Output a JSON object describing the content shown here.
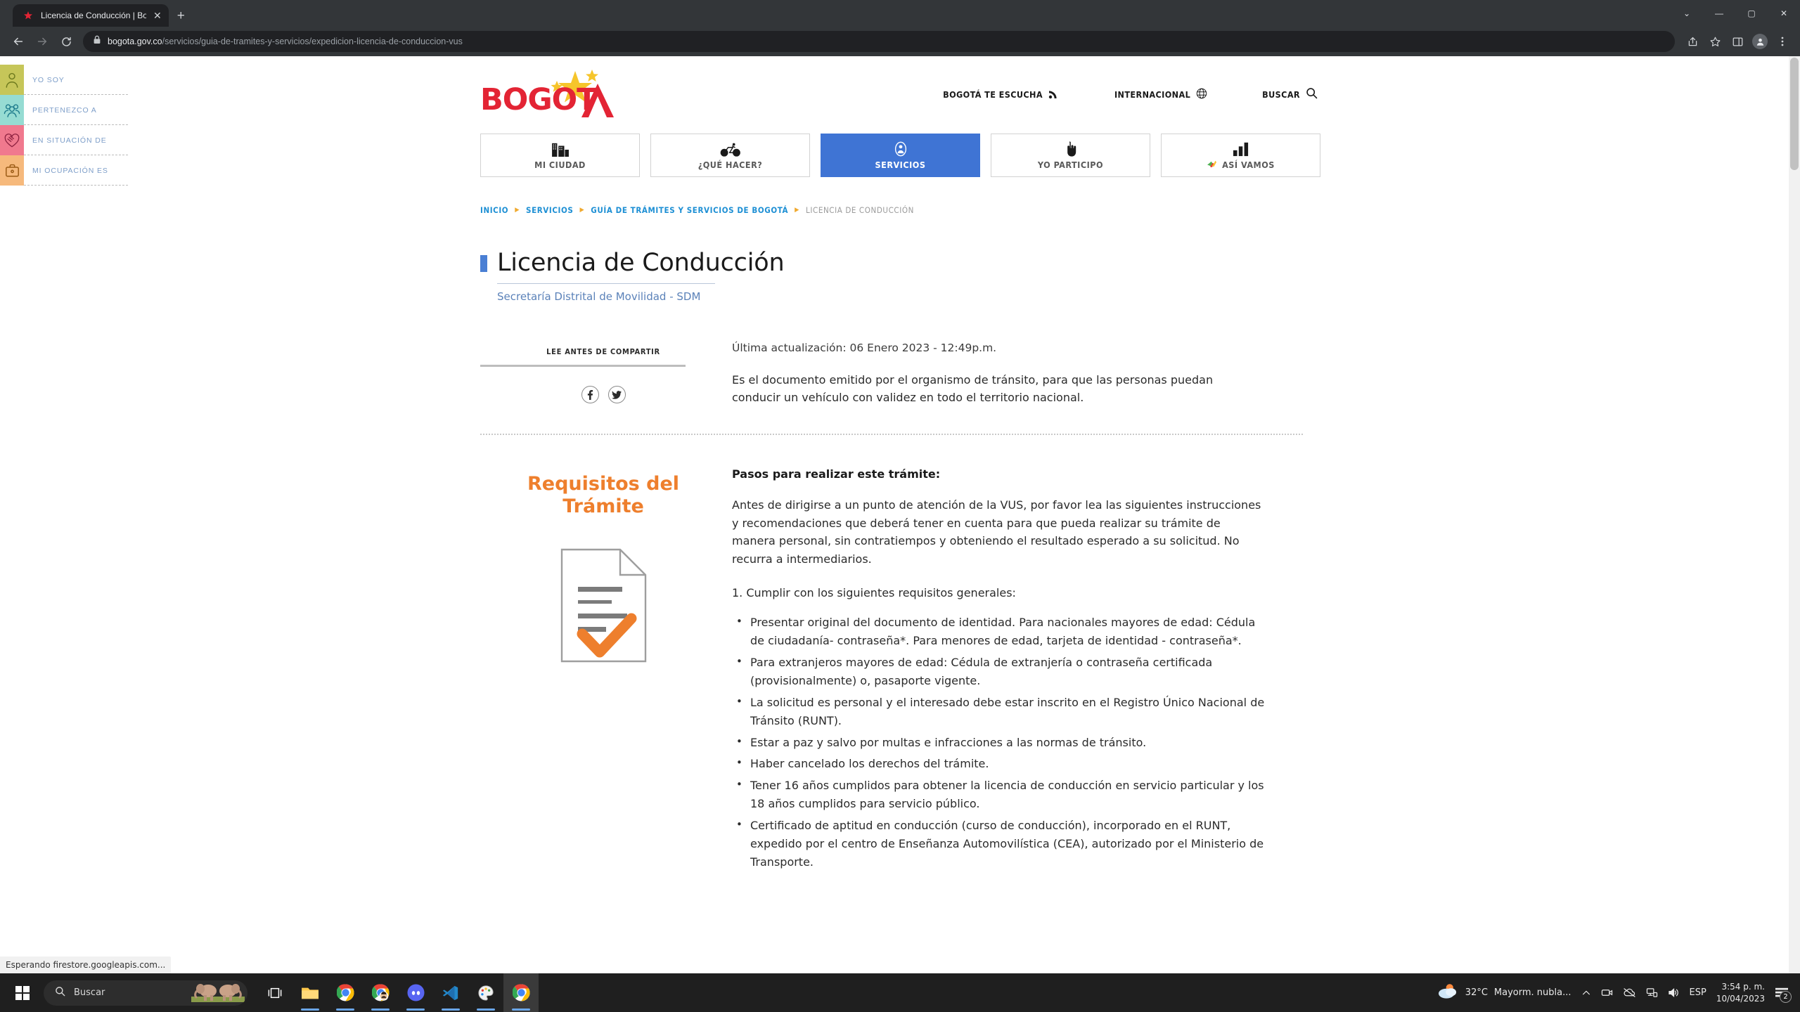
{
  "browser": {
    "tab": {
      "title": "Licencia de Conducción | Bogota.",
      "close_label": "✕"
    },
    "newtab_label": "+",
    "window_controls": {
      "minimize": "—",
      "maximize": "▢",
      "close": "✕",
      "collapse": "⌄"
    },
    "nav": {
      "back": "←",
      "forward": "→",
      "reload": "⟳"
    },
    "omnibox": {
      "domain": "bogota.gov.co",
      "path": "/servicios/guia-de-tramites-y-servicios/expedicion-licencia-de-conduccion-vus"
    },
    "toolbar_icons": [
      "share-icon",
      "bookmark-star-icon",
      "sidepanel-icon",
      "profile-icon",
      "chrome-menu-icon"
    ],
    "status_text": "Esperando firestore.googleapis.com..."
  },
  "sidebar": {
    "items": [
      {
        "label": "YO SOY",
        "icon": "person-icon",
        "color": "#c6c659"
      },
      {
        "label": "PERTENEZCO A",
        "icon": "group-icon",
        "color": "#96dcd3"
      },
      {
        "label": "EN SITUACIÓN DE",
        "icon": "heart-hands-icon",
        "color": "#f0798e"
      },
      {
        "label": "MI OCUPACIÓN ES",
        "icon": "briefcase-icon",
        "color": "#f6b97c"
      }
    ]
  },
  "header": {
    "logo_text": "BOGOT",
    "top_links": [
      {
        "label": "BOGOTÁ TE ESCUCHA",
        "icon": "rss-icon"
      },
      {
        "label": "INTERNACIONAL",
        "icon": "globe-icon"
      },
      {
        "label": "BUSCAR",
        "icon": "search-icon"
      }
    ],
    "tabs": [
      {
        "label": "MI CIUDAD",
        "icon": "buildings-icon",
        "active": false
      },
      {
        "label": "¿QUÉ HACER?",
        "icon": "bicycle-icon",
        "active": false
      },
      {
        "label": "SERVICIOS",
        "icon": "person-circle-icon",
        "active": true
      },
      {
        "label": "YO PARTICIPO",
        "icon": "pointing-hand-icon",
        "active": false
      },
      {
        "label": "ASÍ VAMOS",
        "icon": "bar-chart-icon",
        "active": false
      }
    ],
    "active_accent": "#3f74d4"
  },
  "breadcrumb": {
    "items": [
      "INICIO",
      "SERVICIOS",
      "GUÍA DE TRÁMITES Y SERVICIOS DE BOGOTÁ",
      "LICENCIA DE CONDUCCIÓN"
    ],
    "separator": "▶"
  },
  "page": {
    "title": "Licencia de Conducción",
    "subtitle": "Secretaría Distrital de Movilidad - SDM",
    "share_heading": "LEE ANTES DE COMPARTIR",
    "share_icons": [
      {
        "name": "facebook-icon",
        "glyph": "f"
      },
      {
        "name": "twitter-icon",
        "glyph": "🐦"
      }
    ],
    "updated": "Última actualización: 06 Enero 2023 - 12:49p.m.",
    "description": "Es el documento emitido por el organismo de tránsito, para que las personas puedan conducir un vehículo con validez en todo el territorio nacional.",
    "requirements_title": "Requisitos del Trámite",
    "steps_heading": "Pasos para realizar este trámite:",
    "intro_paragraph": "Antes de dirigirse a un punto de atención de la VUS, por favor lea las siguientes instrucciones y recomendaciones que deberá tener en cuenta para que pueda realizar su trámite de manera personal, sin contratiempos y obteniendo el resultado esperado a su solicitud. No recurra a intermediarios.",
    "step_one": "1. Cumplir con los siguientes requisitos generales:",
    "bullets": [
      "Presentar original del documento de identidad. Para nacionales mayores de edad: Cédula de ciudadanía- contraseña*. Para menores de edad, tarjeta de identidad - contraseña*.",
      "Para extranjeros mayores de edad: Cédula de extranjería o contraseña certificada (provisionalmente) o, pasaporte vigente.",
      "La solicitud es personal y el interesado debe estar inscrito en el Registro Único Nacional de Tránsito (RUNT).",
      "Estar a paz y salvo por multas e infracciones a las normas de tránsito.",
      "Haber cancelado los derechos del trámite.",
      "Tener 16 años cumplidos para obtener la licencia de conducción en servicio particular y los 18 años cumplidos para servicio público.",
      "Certificado de aptitud en conducción (curso de conducción), incorporado en el RUNT, expedido por el centro de Enseñanza Automovilística (CEA), autorizado por el Ministerio de Transporte."
    ]
  },
  "taskbar": {
    "search_placeholder": "Buscar",
    "apps": [
      "task-view-icon",
      "file-explorer-icon",
      "chrome-icon",
      "chrome-profile-icon",
      "discord-icon",
      "vscode-icon",
      "paint-icon",
      "chrome-active-icon"
    ],
    "tray": {
      "temperature": "32°C",
      "weather": "Mayorm. nubla...",
      "language": "ESP",
      "time": "3:54 p. m.",
      "date": "10/04/2023",
      "notification_count": "2",
      "icons": [
        "chevron-up-icon",
        "camera-icon",
        "onedrive-icon",
        "network-icon",
        "volume-icon"
      ]
    }
  },
  "colors": {
    "brand_red": "#e32434",
    "brand_yellow": "#f6c52b",
    "accent_blue": "#3f74d4",
    "link_blue": "#1d8fd4",
    "orange": "#ee7f2d"
  }
}
